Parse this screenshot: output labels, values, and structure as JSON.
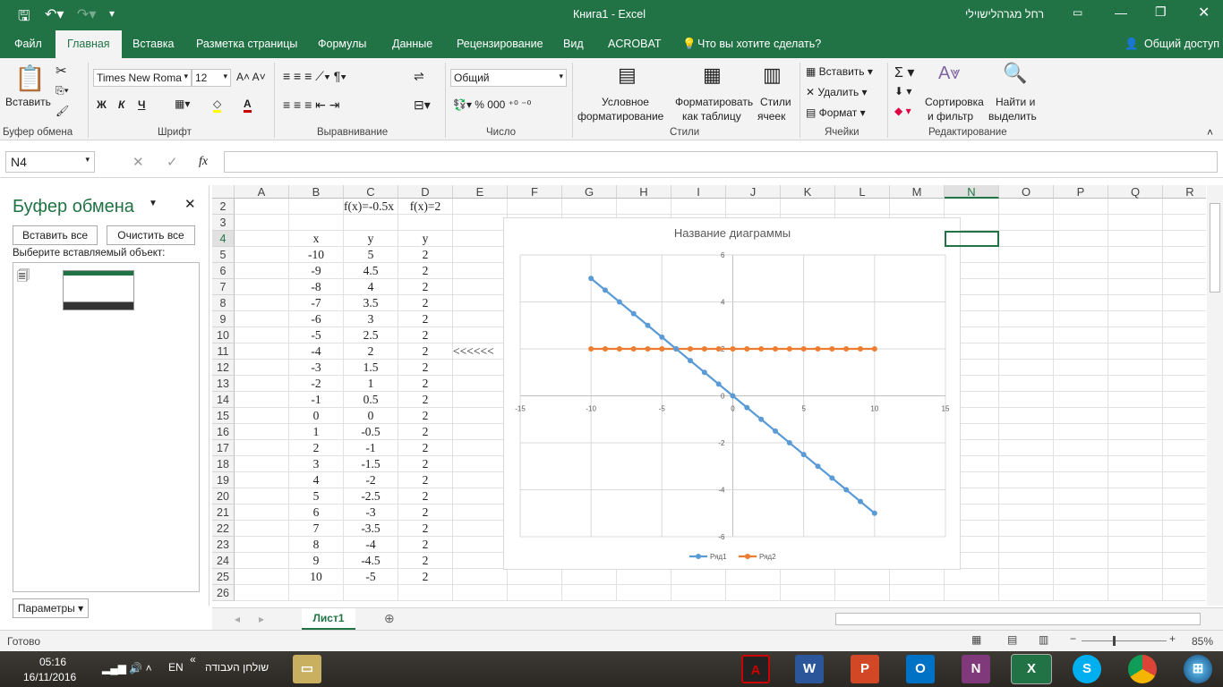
{
  "window": {
    "title": "Книга1  -  Excel",
    "user": "רחל מגרהלישוילי"
  },
  "tabs": [
    "Файл",
    "Главная",
    "Вставка",
    "Разметка страницы",
    "Формулы",
    "Данные",
    "Рецензирование",
    "Вид",
    "ACROBAT"
  ],
  "tell_me": "Что вы хотите сделать?",
  "share": "Общий доступ",
  "ribbon": {
    "paste": "Вставить",
    "font_name": "Times New Roma",
    "font_size": "12",
    "bold": "Ж",
    "italic": "К",
    "underline": "Ч",
    "number_format": "Общий",
    "cond_format": [
      "Условное",
      "форматирование"
    ],
    "format_table": [
      "Форматировать",
      "как таблицу"
    ],
    "cell_styles": [
      "Стили",
      "ячеек"
    ],
    "insert": "Вставить",
    "delete": "Удалить",
    "format": "Формат",
    "sort": [
      "Сортировка",
      "и фильтр"
    ],
    "find": [
      "Найти и",
      "выделить"
    ],
    "groups": [
      "Буфер обмена",
      "Шрифт",
      "Выравнивание",
      "Число",
      "Стили",
      "Ячейки",
      "Редактирование"
    ]
  },
  "formula_bar": {
    "name_box": "N4",
    "formula": "",
    "fx": "fx"
  },
  "clipboard_pane": {
    "title": "Буфер обмена",
    "paste_all": "Вставить все",
    "clear_all": "Очистить все",
    "prompt": "Выберите вставляемый объект:",
    "options": "Параметры"
  },
  "columns": [
    "A",
    "B",
    "C",
    "D",
    "E",
    "F",
    "G",
    "H",
    "I",
    "J",
    "K",
    "L",
    "M",
    "N",
    "O",
    "P",
    "Q",
    "R"
  ],
  "rows": [
    {
      "n": "2",
      "B": "",
      "C": "f(x)=-0.5x",
      "D": "f(x)=2"
    },
    {
      "n": "3",
      "B": "",
      "C": "",
      "D": ""
    },
    {
      "n": "4",
      "B": "x",
      "C": "y",
      "D": "y"
    },
    {
      "n": "5",
      "B": "-10",
      "C": "5",
      "D": "2"
    },
    {
      "n": "6",
      "B": "-9",
      "C": "4.5",
      "D": "2"
    },
    {
      "n": "7",
      "B": "-8",
      "C": "4",
      "D": "2"
    },
    {
      "n": "8",
      "B": "-7",
      "C": "3.5",
      "D": "2"
    },
    {
      "n": "9",
      "B": "-6",
      "C": "3",
      "D": "2"
    },
    {
      "n": "10",
      "B": "-5",
      "C": "2.5",
      "D": "2"
    },
    {
      "n": "11",
      "B": "-4",
      "C": "2",
      "D": "2",
      "E": "<<<<<<"
    },
    {
      "n": "12",
      "B": "-3",
      "C": "1.5",
      "D": "2"
    },
    {
      "n": "13",
      "B": "-2",
      "C": "1",
      "D": "2"
    },
    {
      "n": "14",
      "B": "-1",
      "C": "0.5",
      "D": "2"
    },
    {
      "n": "15",
      "B": "0",
      "C": "0",
      "D": "2"
    },
    {
      "n": "16",
      "B": "1",
      "C": "-0.5",
      "D": "2"
    },
    {
      "n": "17",
      "B": "2",
      "C": "-1",
      "D": "2"
    },
    {
      "n": "18",
      "B": "3",
      "C": "-1.5",
      "D": "2"
    },
    {
      "n": "19",
      "B": "4",
      "C": "-2",
      "D": "2"
    },
    {
      "n": "20",
      "B": "5",
      "C": "-2.5",
      "D": "2"
    },
    {
      "n": "21",
      "B": "6",
      "C": "-3",
      "D": "2"
    },
    {
      "n": "22",
      "B": "7",
      "C": "-3.5",
      "D": "2"
    },
    {
      "n": "23",
      "B": "8",
      "C": "-4",
      "D": "2"
    },
    {
      "n": "24",
      "B": "9",
      "C": "-4.5",
      "D": "2"
    },
    {
      "n": "25",
      "B": "10",
      "C": "-5",
      "D": "2"
    },
    {
      "n": "26",
      "B": "",
      "C": "",
      "D": ""
    }
  ],
  "chart_data": {
    "type": "scatter",
    "title": "Название диаграммы",
    "xlim": [
      -15,
      15
    ],
    "ylim": [
      -6,
      6
    ],
    "xticks": [
      -15,
      -10,
      -5,
      0,
      5,
      10,
      15
    ],
    "yticks": [
      -6,
      -4,
      -2,
      0,
      2,
      4,
      6
    ],
    "grid": true,
    "legend": "bottom",
    "x": [
      -10,
      -9,
      -8,
      -7,
      -6,
      -5,
      -4,
      -3,
      -2,
      -1,
      0,
      1,
      2,
      3,
      4,
      5,
      6,
      7,
      8,
      9,
      10
    ],
    "series": [
      {
        "name": "Ряд1",
        "color": "#5b9bd5",
        "values": [
          5,
          4.5,
          4,
          3.5,
          3,
          2.5,
          2,
          1.5,
          1,
          0.5,
          0,
          -0.5,
          -1,
          -1.5,
          -2,
          -2.5,
          -3,
          -3.5,
          -4,
          -4.5,
          -5
        ]
      },
      {
        "name": "Ряд2",
        "color": "#ed7d31",
        "values": [
          2,
          2,
          2,
          2,
          2,
          2,
          2,
          2,
          2,
          2,
          2,
          2,
          2,
          2,
          2,
          2,
          2,
          2,
          2,
          2,
          2
        ]
      }
    ]
  },
  "sheet_tab": "Лист1",
  "status": {
    "ready": "Готово",
    "zoom": "85%"
  },
  "taskbar": {
    "time": "05:16",
    "date": "16/11/2016",
    "lang": "EN",
    "desktop": "שולחן העבודה"
  }
}
